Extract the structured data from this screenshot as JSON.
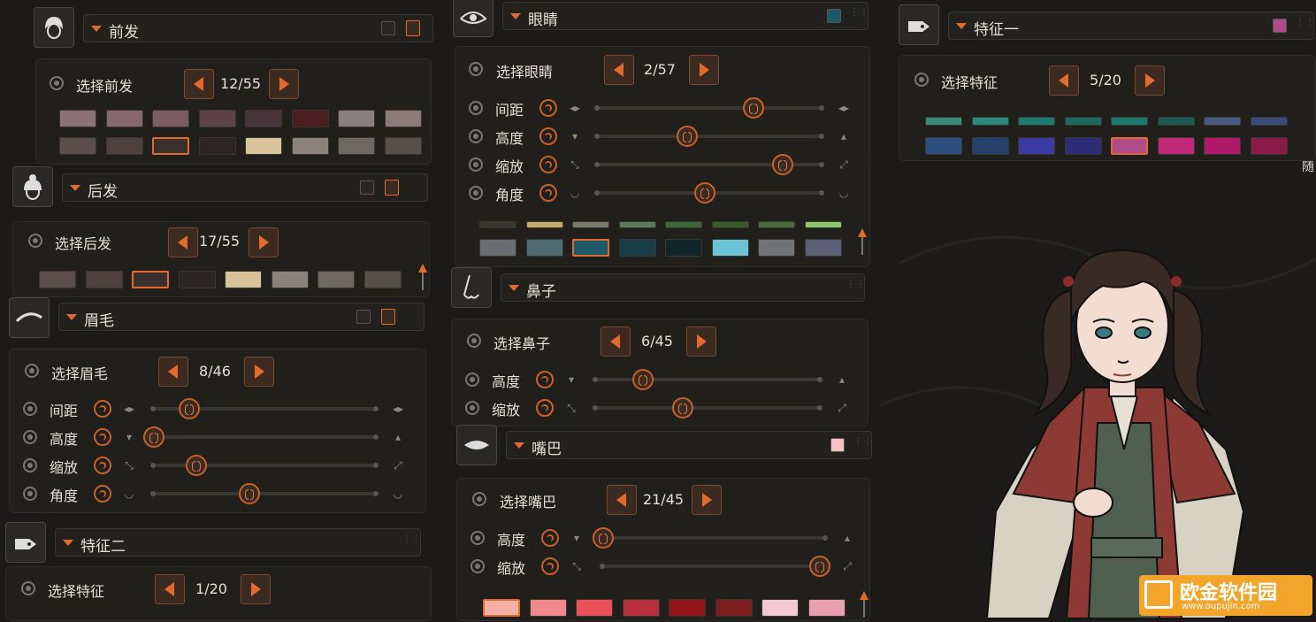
{
  "panels": {
    "front_hair": {
      "title": "前发",
      "select_label": "选择前发",
      "counter": "12/55"
    },
    "back_hair": {
      "title": "后发",
      "select_label": "选择后发",
      "counter": "17/55"
    },
    "eyebrow": {
      "title": "眉毛",
      "select_label": "选择眉毛",
      "counter": "8/46"
    },
    "feature2": {
      "title": "特征二",
      "select_label": "选择特征",
      "counter": "1/20"
    },
    "eyes": {
      "title": "眼睛",
      "select_label": "选择眼睛",
      "counter": "2/57",
      "color": "#1f5a6a"
    },
    "nose": {
      "title": "鼻子",
      "select_label": "选择鼻子",
      "counter": "6/45"
    },
    "mouth": {
      "title": "嘴巴",
      "select_label": "选择嘴巴",
      "counter": "21/45",
      "color": "#f7c3c2"
    },
    "feature1": {
      "title": "特征一",
      "select_label": "选择特征",
      "counter": "5/20",
      "color": "#b04a88"
    }
  },
  "slider_labels": {
    "spacing": "间距",
    "height": "高度",
    "scale": "缩放",
    "angle": "角度"
  },
  "slider_values": {
    "eyes": {
      "spacing": 0.7,
      "height": 0.4,
      "scale": 0.83,
      "angle": 0.48
    },
    "eyebrow": {
      "spacing": 0.16,
      "height": 0.0,
      "scale": 0.19,
      "angle": 0.43
    },
    "nose": {
      "height": 0.21,
      "scale": 0.39
    },
    "mouth": {
      "height": 0.0,
      "scale": 0.98
    }
  },
  "swatches": {
    "front_hair_row1": [
      "#8a7276",
      "#85676d",
      "#7a5c62",
      "#5c4247",
      "#47343a",
      "#4a1d21",
      "#8a7f7f",
      "#8d7a7a"
    ],
    "front_hair_row2": [
      "#5c4f4b",
      "#4d403d",
      "#3a302e",
      "#2b2623",
      "#d8c49a",
      "#8b827c",
      "#6e6863",
      "#55504b"
    ],
    "back_hair_row": [
      "#5c4f4b",
      "#4d403d",
      "#3a302e",
      "#2b2623",
      "#d8c49a",
      "#8b827c",
      "#6e6863",
      "#55504b"
    ],
    "eyes_row_top": [
      "#3a3733",
      "#c9a96a",
      "#7a7a6a",
      "#5a7a5a",
      "#3a6a3a",
      "#3a5a2a",
      "#4a6a3a",
      "#8ac86a"
    ],
    "eyes_row": [
      "#6a6e72",
      "#4f6a72",
      "#1f5a6a",
      "#173e48",
      "#12252a",
      "#6cc3d5",
      "#707479",
      "#5c5f78"
    ],
    "feature1_row_top": [
      "#3a8a7a",
      "#2a8a80",
      "#1f7a70",
      "#1a6a60",
      "#1a7a70",
      "#1a5a50",
      "#4a5a80",
      "#3a4a7a"
    ],
    "feature1_row": [
      "#2d4f80",
      "#25406a",
      "#3a3aa0",
      "#2c2c78",
      "#b04a88",
      "#c02a78",
      "#b01a68",
      "#8a1a48"
    ],
    "mouth_row": [
      "#f7b0a8",
      "#f08a8e",
      "#e8505a",
      "#b83040",
      "#901418",
      "#7a1e22",
      "#f2c8d2",
      "#e8a0b0"
    ]
  },
  "watermark": "欧金软件园",
  "watermark_url": "www.oupujin.com",
  "clipped_text": "随"
}
